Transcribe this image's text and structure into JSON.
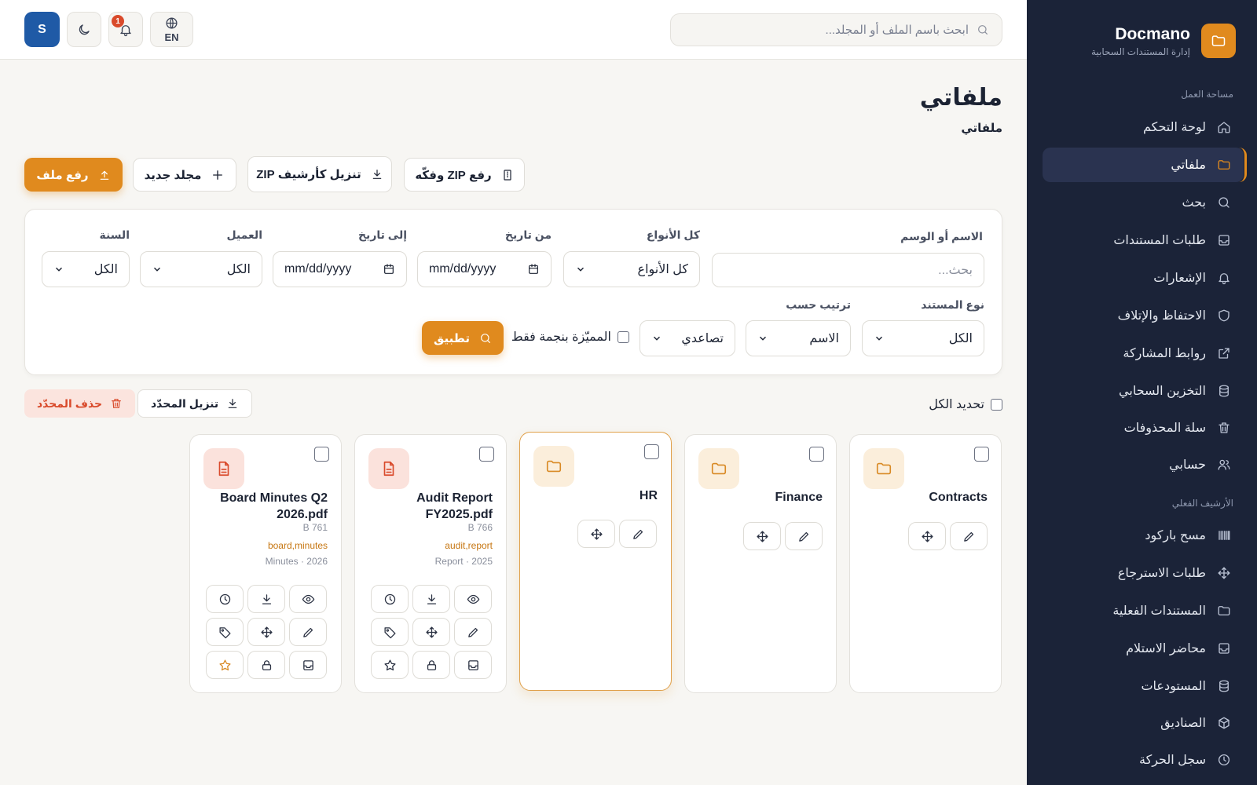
{
  "brand": {
    "name": "Docmano",
    "subtitle": "إدارة المستندات السحابية"
  },
  "sidebar": {
    "workspace_label": "مساحة العمل",
    "items": [
      {
        "label": "لوحة التحكم",
        "icon": "home-icon"
      },
      {
        "label": "ملفاتي",
        "icon": "folder-icon",
        "active": true
      },
      {
        "label": "بحث",
        "icon": "search-icon"
      },
      {
        "label": "طلبات المستندات",
        "icon": "inbox-icon"
      },
      {
        "label": "الإشعارات",
        "icon": "bell-icon"
      },
      {
        "label": "الاحتفاظ والإتلاف",
        "icon": "shield-icon"
      },
      {
        "label": "روابط المشاركة",
        "icon": "external-link-icon"
      },
      {
        "label": "التخزين السحابي",
        "icon": "database-icon"
      },
      {
        "label": "سلة المحذوفات",
        "icon": "trash-icon"
      },
      {
        "label": "حسابي",
        "icon": "users-icon"
      }
    ],
    "archive_label": "الأرشيف الفعلي",
    "archive_items": [
      {
        "label": "مسح باركود",
        "icon": "barcode-icon"
      },
      {
        "label": "طلبات الاسترجاع",
        "icon": "move-icon"
      },
      {
        "label": "المستندات الفعلية",
        "icon": "folder-icon"
      },
      {
        "label": "محاضر الاستلام",
        "icon": "inbox-icon"
      },
      {
        "label": "المستودعات",
        "icon": "database-icon"
      },
      {
        "label": "الصناديق",
        "icon": "box-icon"
      },
      {
        "label": "سجل الحركة",
        "icon": "clock-icon"
      }
    ]
  },
  "header": {
    "search_placeholder": "ابحث باسم الملف أو المجلد...",
    "lang": "EN",
    "notification_count": "1",
    "avatar_initial": "S"
  },
  "page": {
    "title": "ملفاتي",
    "breadcrumb": "ملفاتي"
  },
  "actions": {
    "upload": "رفع ملف",
    "new_folder": "مجلد جديد",
    "download_zip": "تنزيل كأرشيف ZIP",
    "upload_zip": "رفع ZIP وفكّه"
  },
  "filters": {
    "name_label": "الاسم أو الوسم",
    "name_placeholder": "بحث...",
    "types_label": "كل الأنواع",
    "types_value": "كل الأنواع",
    "from_label": "من تاريخ",
    "from_value": "mm/dd/yyyy",
    "to_label": "إلى تاريخ",
    "to_value": "mm/dd/yyyy",
    "client_label": "العميل",
    "client_value": "الكل",
    "year_label": "السنة",
    "year_value": "الكل",
    "doctype_label": "نوع المستند",
    "doctype_value": "الكل",
    "sort_label": "ترتيب حسب",
    "sort_value": "الاسم",
    "order_value": "تصاعدي",
    "starred_label": "المميّزة بنجمة فقط",
    "apply": "تطبيق"
  },
  "bulk": {
    "select_all": "تحديد الكل",
    "download_selected": "تنزيل المحدّد",
    "delete_selected": "حذف المحدّد"
  },
  "items": [
    {
      "name": "Contracts",
      "kind": "folder"
    },
    {
      "name": "Finance",
      "kind": "folder"
    },
    {
      "name": "HR",
      "kind": "folder"
    },
    {
      "name": "Audit Report FY2025.pdf",
      "kind": "file",
      "size": "766 B",
      "tags": "audit,report",
      "meta": "Report · 2025"
    },
    {
      "name": "Board Minutes Q2 2026.pdf",
      "kind": "file",
      "size": "761 B",
      "tags": "board,minutes",
      "meta": "Minutes · 2026"
    }
  ],
  "colors": {
    "accent": "#e08a1e",
    "sidebar": "#1b2338",
    "danger": "#d94a2b"
  }
}
